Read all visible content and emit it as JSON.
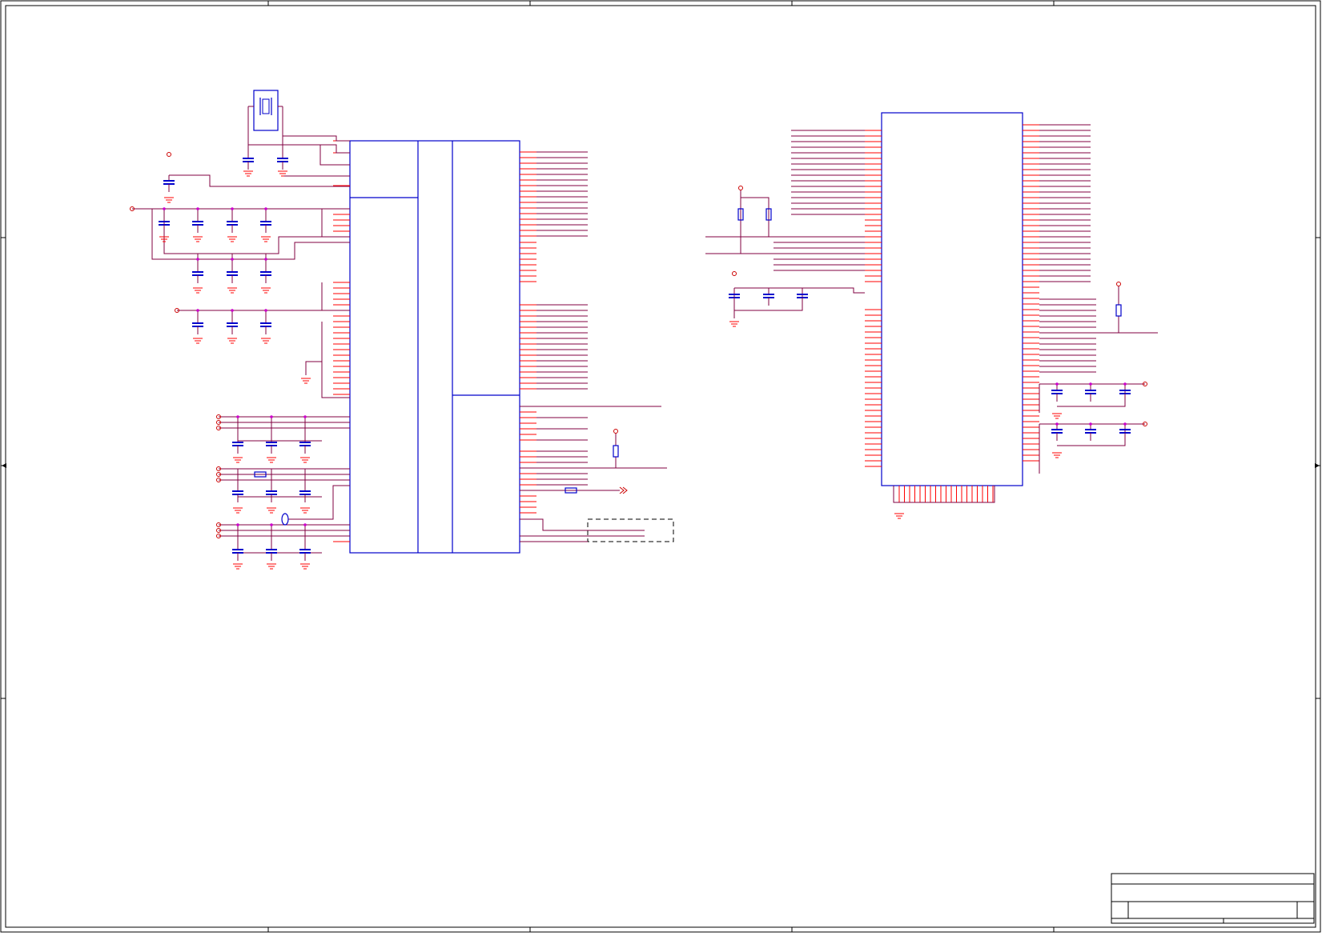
{
  "sheet": {
    "description": "",
    "border_zone_labels": [],
    "title_block": {
      "title": "",
      "document_number": "",
      "revision": "",
      "sheet": "",
      "date": ""
    }
  },
  "colors": {
    "frame": "#000000",
    "part_body": "#0000cc",
    "wire": "#800040",
    "pin": "#ff0000",
    "junction": "#cc00cc",
    "ground": "#ff0000",
    "power_port": "#cc0000",
    "dashed_box": "#000000"
  },
  "components": {
    "u1": {
      "designator": "",
      "part": "",
      "pin_labels": []
    },
    "u2": {
      "designator": "",
      "part": "",
      "pin_labels": []
    },
    "crystal": {
      "designator": "",
      "value": ""
    },
    "capacitors": [],
    "resistors": [],
    "net_labels": []
  }
}
